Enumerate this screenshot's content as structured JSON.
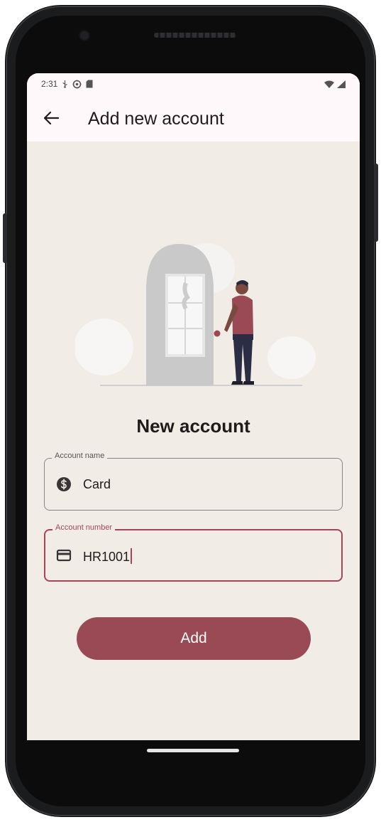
{
  "status_bar": {
    "time": "2:31"
  },
  "app_bar": {
    "title": "Add new account"
  },
  "form": {
    "title": "New account",
    "account_name": {
      "label": "Account name",
      "value": "Card"
    },
    "account_number": {
      "label": "Account number",
      "value": "HR1001"
    },
    "submit_label": "Add"
  },
  "colors": {
    "primary": "#9a4a55",
    "focus": "#a54557",
    "background": "#f1ede6",
    "app_bar": "#fff8fa"
  }
}
